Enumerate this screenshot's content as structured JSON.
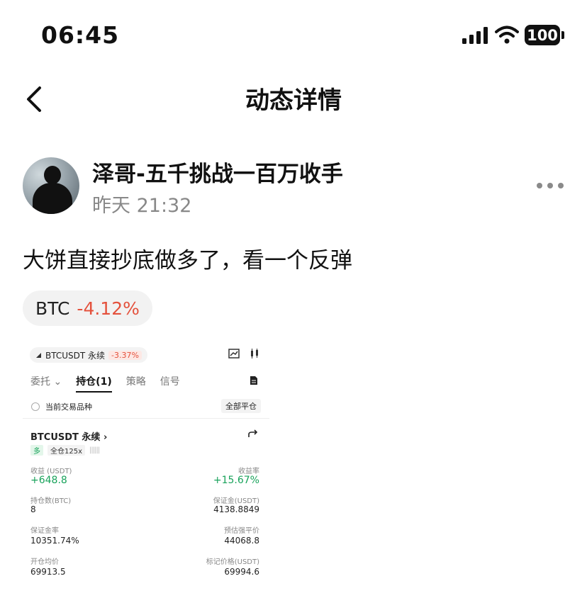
{
  "status_bar": {
    "time": "06:45",
    "battery": "100"
  },
  "nav": {
    "title": "动态详情"
  },
  "post": {
    "author": "泽哥-五千挑战一百万收手",
    "time": "昨天 21:32",
    "content": "大饼直接抄底做多了，看一个反弹",
    "tag": {
      "symbol": "BTC",
      "change": "-4.12%"
    }
  },
  "screenshot": {
    "pair": "BTCUSDT 永续",
    "pair_change": "-3.37%",
    "tabs": [
      "委托",
      "持仓(1)",
      "策略",
      "信号"
    ],
    "filter_label": "当前交易品种",
    "close_all": "全部平仓",
    "position": {
      "title": "BTCUSDT 永续",
      "side": "多",
      "margin_mode": "全仓125x",
      "pnl_label": "收益 (USDT)",
      "pnl_value": "+648.8",
      "roe_label": "收益率",
      "roe_value": "+15.67%",
      "size_label": "持仓数(BTC)",
      "size_value": "8",
      "margin_label": "保证金(USDT)",
      "margin_value": "4138.8849",
      "margin_ratio_label": "保证金率",
      "margin_ratio_value": "10351.74%",
      "liq_label": "预估强平价",
      "liq_value": "44068.8",
      "entry_label": "开仓均价",
      "entry_value": "69913.5",
      "mark_label": "标记价格(USDT)",
      "mark_value": "69994.6"
    }
  },
  "colors": {
    "negative": "#e4513c",
    "positive": "#19a35b"
  }
}
